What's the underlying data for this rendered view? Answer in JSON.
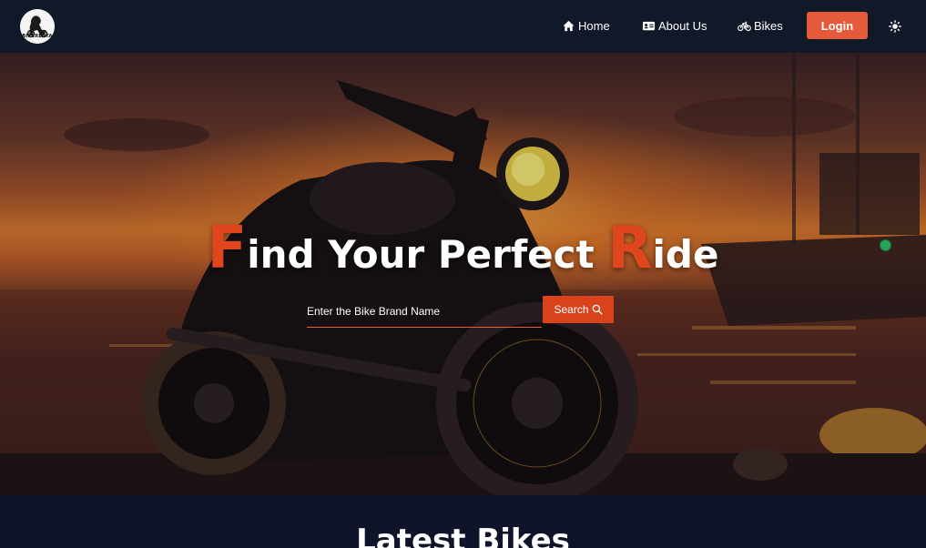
{
  "nav": {
    "logo_text": "BIKERENTA",
    "links": [
      {
        "label": "Home",
        "icon": "home-icon"
      },
      {
        "label": "About Us",
        "icon": "id-card-icon"
      },
      {
        "label": "Bikes",
        "icon": "bicycle-icon"
      }
    ],
    "login_label": "Login",
    "theme_icon": "sun-icon"
  },
  "hero": {
    "title_first_letter": "F",
    "title_part1": "ind Your Perfect ",
    "title_second_letter": "R",
    "title_part2": "ide",
    "search_placeholder": "Enter the Bike Brand Name",
    "search_label": "Search",
    "search_icon": "magnifier-icon"
  },
  "section": {
    "title": "Latest Bikes"
  },
  "colors": {
    "accent": "#e45a3a",
    "title_highlight": "#e0461e",
    "navbar_bg": "#111827"
  }
}
